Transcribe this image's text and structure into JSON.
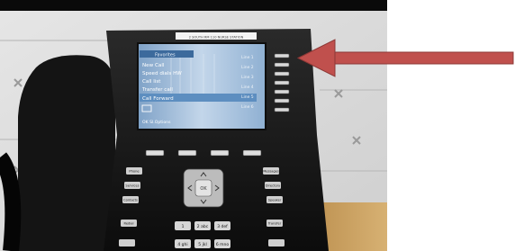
{
  "image": {
    "subject": "desk-phone",
    "colors": {
      "background_page": "#ffffff",
      "photo_top_bar": "#0a0a0a",
      "wall_panel": "#dcdcdc",
      "phone_body": "#151515",
      "screen_blue": "#a9c3dc",
      "arrow": "#c0504d",
      "desk_wood": "#c9a15e"
    }
  },
  "phone": {
    "label_strip": "2 SOUTH RM 110 NURSE STATION",
    "screen": {
      "header": "Favorites",
      "menu_items": [
        "New Call",
        "Speed dials HW",
        "Call list",
        "Transfer call",
        "Call Forward"
      ],
      "right_labels": [
        "Line 1",
        "Line 2",
        "Line 3",
        "Line 4",
        "Line 5",
        "Line 6"
      ],
      "footer": "OK Sl.Options"
    },
    "keys": {
      "left": [
        "Phone",
        "Services",
        "Contacts",
        "Redial"
      ],
      "right": [
        "Messages",
        "Directory",
        "Speaker",
        "Transfer"
      ],
      "keypad": [
        "1",
        "2 abc",
        "3 def",
        "4 ghi",
        "5 jkl",
        "6 mno"
      ],
      "nav_ok": "OK"
    }
  }
}
